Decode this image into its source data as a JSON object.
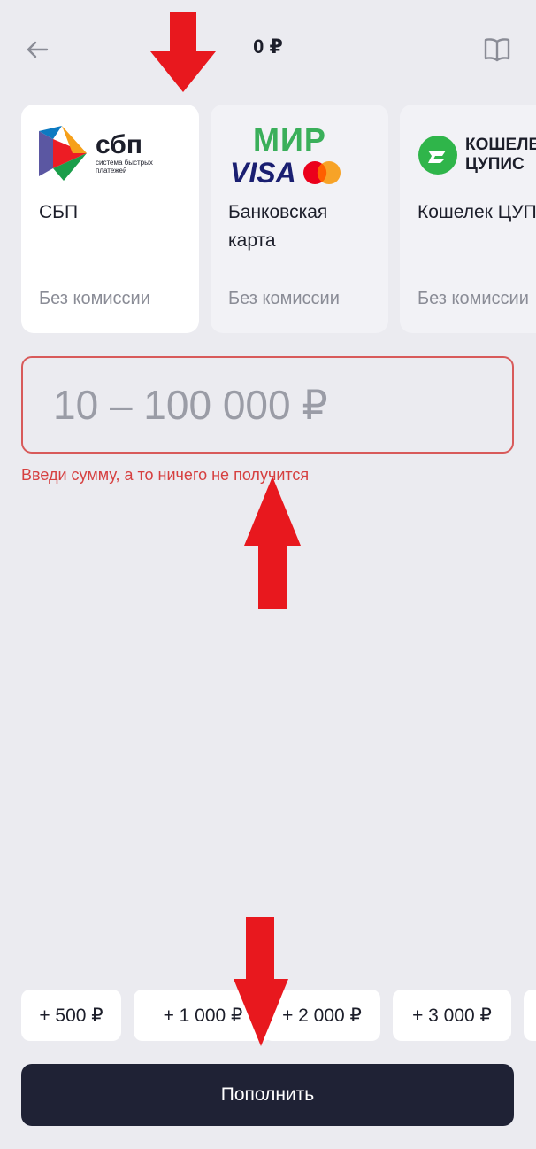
{
  "header": {
    "balance": "0 ₽",
    "back_icon": "arrow-left-icon",
    "guide_icon": "book-icon"
  },
  "payment_methods": [
    {
      "name": "СБП",
      "fee": "Без комиссии",
      "logo_text": "сбп",
      "logo_subtext": "система быстрых платежей",
      "selected": true
    },
    {
      "name": "Банковская карта",
      "fee": "Без комиссии",
      "logo_text_top": "МИР",
      "logo_text_bottom": "VISA",
      "selected": false
    },
    {
      "name": "Кошелек ЦУПИС",
      "fee": "Без комиссии",
      "logo_text_line1": "КОШЕЛЕК",
      "logo_text_line2": "ЦУПИС",
      "selected": false
    }
  ],
  "amount": {
    "value": "",
    "placeholder": "10 – 100 000 ₽",
    "error": "Введи сумму, а то ничего не получится"
  },
  "quick_amounts": [
    "+ 500 ₽",
    "+ 1 000 ₽",
    "+ 2 000 ₽",
    "+ 3 000 ₽"
  ],
  "submit_label": "Пополнить",
  "colors": {
    "background": "#ebebf0",
    "error": "#d64040",
    "primary_button": "#1f2235",
    "annotation_arrow": "#e8181e"
  }
}
